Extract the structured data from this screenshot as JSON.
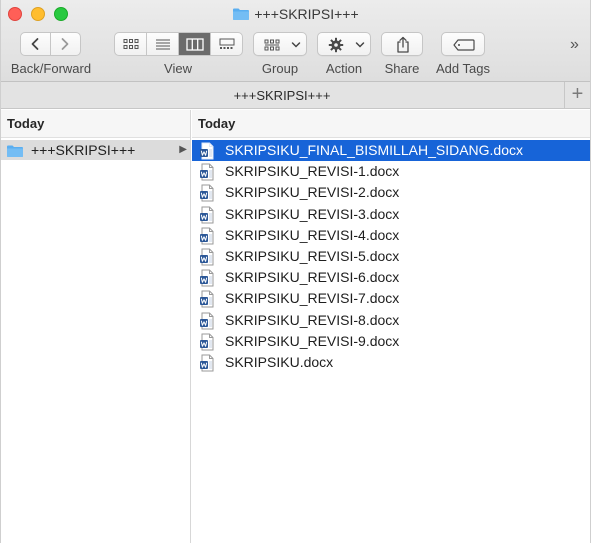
{
  "window": {
    "title": "+++SKRIPSI+++"
  },
  "toolbar": {
    "back_forward_label": "Back/Forward",
    "view_label": "View",
    "group_label": "Group",
    "action_label": "Action",
    "share_label": "Share",
    "add_tags_label": "Add Tags",
    "overflow_glyph": "»"
  },
  "pathbar": {
    "title": "+++SKRIPSI+++",
    "add_glyph": "+"
  },
  "column1": {
    "header": "Today",
    "folder": "+++SKRIPSI+++",
    "arrow": "▶"
  },
  "column2": {
    "header": "Today",
    "files": [
      "SKRIPSIKU_FINAL_BISMILLAH_SIDANG.docx",
      "SKRIPSIKU_REVISI-1.docx",
      "SKRIPSIKU_REVISI-2.docx",
      "SKRIPSIKU_REVISI-3.docx",
      "SKRIPSIKU_REVISI-4.docx",
      "SKRIPSIKU_REVISI-5.docx",
      "SKRIPSIKU_REVISI-6.docx",
      "SKRIPSIKU_REVISI-7.docx",
      "SKRIPSIKU_REVISI-8.docx",
      "SKRIPSIKU_REVISI-9.docx",
      "SKRIPSIKU.docx"
    ]
  },
  "colors": {
    "selection": "#1764d8",
    "folder_blue": "#5aaef0",
    "word_blue": "#2b5797"
  }
}
